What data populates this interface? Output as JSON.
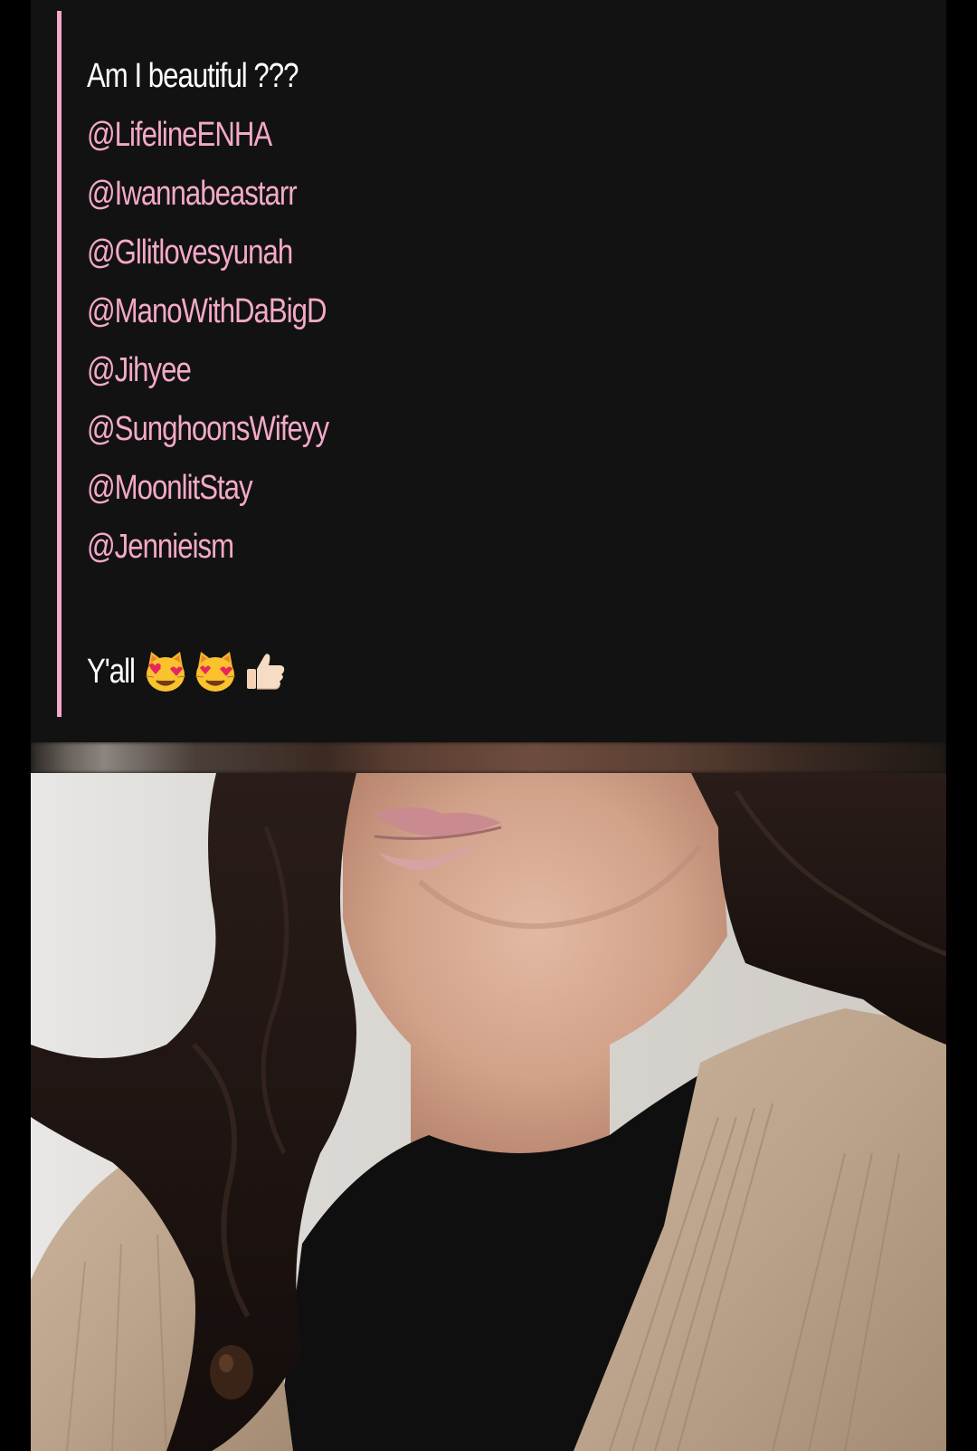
{
  "post": {
    "title_line": "Am I beautiful ???",
    "mentions": [
      "@LifelineENHA",
      "@Iwannabeastarr",
      "@Gllitlovesyunah",
      "@ManoWithDaBigD",
      "@Jihyee",
      "@SunghoonsWifeyy",
      "@MoonlitStay",
      "@Jennieism"
    ],
    "closing_text": "Y'all",
    "closing_emojis": [
      "heart-eyes-cat-icon",
      "heart-eyes-cat-icon",
      "thumbs-up-icon"
    ]
  },
  "colors": {
    "background": "#000000",
    "card": "#121212",
    "accent_border": "#f2a8c8",
    "mention": "#f4a9c9",
    "text": "#ffffff"
  },
  "image": {
    "subject": "photo-of-person-in-black-top-and-beige-cardigan"
  }
}
